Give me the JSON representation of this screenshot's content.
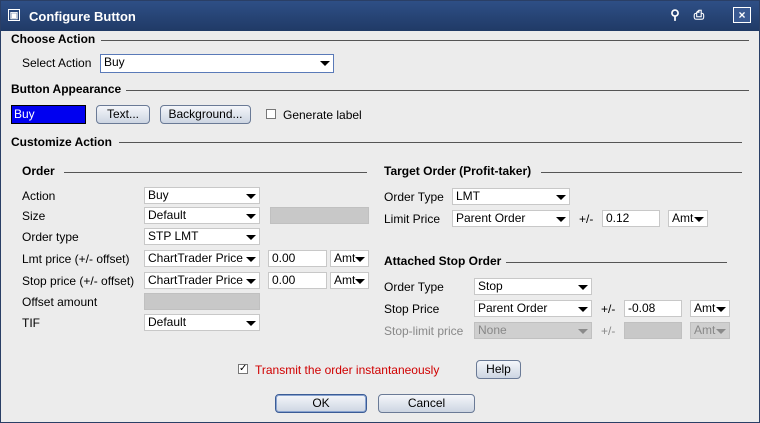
{
  "window": {
    "title": "Configure Button",
    "close_glyph": "×"
  },
  "choose_action": {
    "heading": "Choose Action",
    "select_label": "Select Action",
    "select_value": "Buy"
  },
  "appearance": {
    "heading": "Button Appearance",
    "preview_text": "Buy",
    "preview_color": "#0000f0",
    "text_button": "Text...",
    "background_button": "Background...",
    "generate_label": "Generate label",
    "generate_checked": false
  },
  "customize": {
    "heading": "Customize Action"
  },
  "order": {
    "heading": "Order",
    "action": {
      "label": "Action",
      "value": "Buy"
    },
    "size": {
      "label": "Size",
      "value": "Default"
    },
    "order_type": {
      "label": "Order type",
      "value": "STP LMT"
    },
    "lmt_price": {
      "label": "Lmt price (+/- offset)",
      "value": "ChartTrader Price",
      "offset": "0.00",
      "unit": "Amt"
    },
    "stop_price": {
      "label": "Stop price (+/- offset)",
      "value": "ChartTrader Price",
      "offset": "0.00",
      "unit": "Amt"
    },
    "offset_amount": {
      "label": "Offset amount"
    },
    "tif": {
      "label": "TIF",
      "value": "Default"
    }
  },
  "target": {
    "heading": "Target Order (Profit-taker)",
    "order_type": {
      "label": "Order Type",
      "value": "LMT"
    },
    "limit_price": {
      "label": "Limit Price",
      "value": "Parent Order",
      "pm": "+/-",
      "offset": "0.12",
      "unit": "Amt"
    }
  },
  "stop": {
    "heading": "Attached Stop Order",
    "order_type": {
      "label": "Order Type",
      "value": "Stop"
    },
    "stop_price": {
      "label": "Stop Price",
      "value": "Parent Order",
      "pm": "+/-",
      "offset": "-0.08",
      "unit": "Amt"
    },
    "stop_limit": {
      "label": "Stop-limit price",
      "value": "None",
      "pm": "+/-",
      "unit": "Amt"
    }
  },
  "footer": {
    "transmit_label": "Transmit the order instantaneously",
    "transmit_checked": true,
    "check_glyph": "✓",
    "help": "Help",
    "ok": "OK",
    "cancel": "Cancel"
  },
  "colors": {
    "titlebar": "#203a66",
    "transmit_text": "#d00000"
  }
}
